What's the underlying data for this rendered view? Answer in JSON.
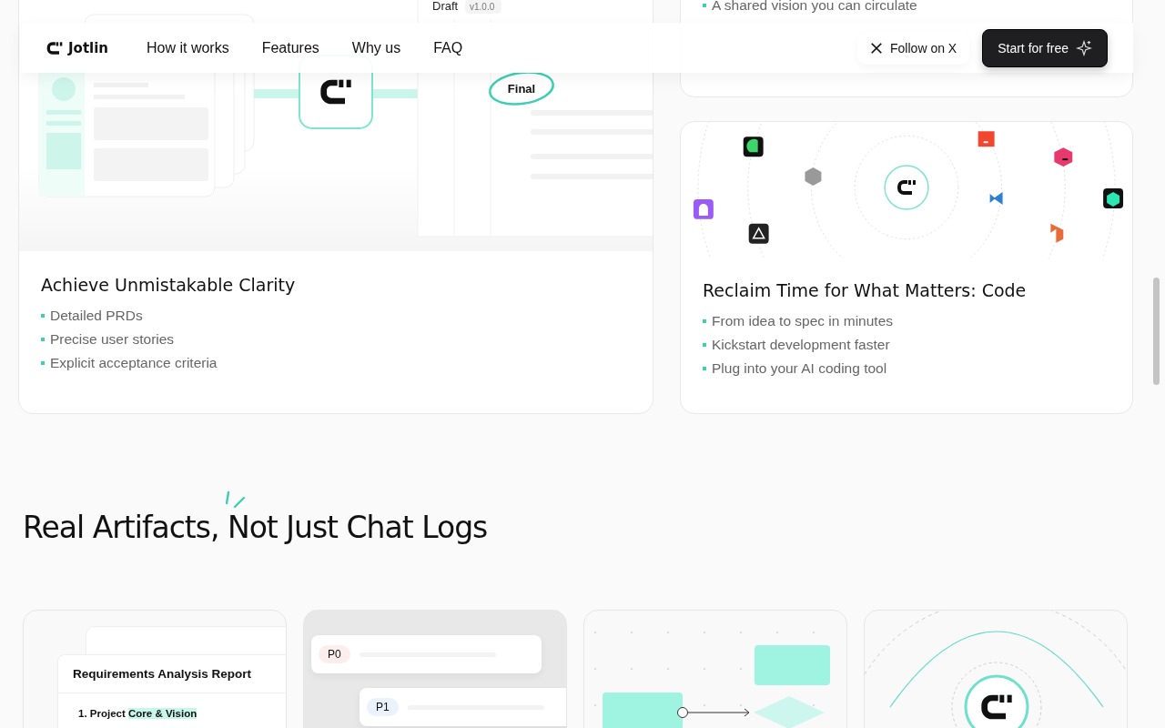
{
  "nav": {
    "brand": "Jotlin",
    "links": [
      "How it works",
      "Features",
      "Why us",
      "FAQ"
    ],
    "follow": "Follow on X",
    "cta": "Start for free"
  },
  "clarity_card": {
    "draft": "Draft",
    "version": "v1.0.0",
    "final": "Final",
    "title": "Achieve Unmistakable Clarity",
    "bullets": [
      "Detailed PRDs",
      "Precise user stories",
      "Explicit acceptance criteria"
    ]
  },
  "vision_card": {
    "bullets": [
      "A shared vision you can circulate"
    ]
  },
  "code_card": {
    "title": "Reclaim Time for What Matters: Code",
    "bullets": [
      "From idea to spec in minutes",
      "Kickstart development faster",
      "Plug into your AI coding tool"
    ]
  },
  "artifacts": {
    "heading": "Real Artifacts, Not Just Chat Logs",
    "report": {
      "title": "Requirements Analysis Report",
      "item": "1. Project",
      "highlight": "Core & Vision"
    },
    "priorities": [
      "P0",
      "P1"
    ]
  }
}
